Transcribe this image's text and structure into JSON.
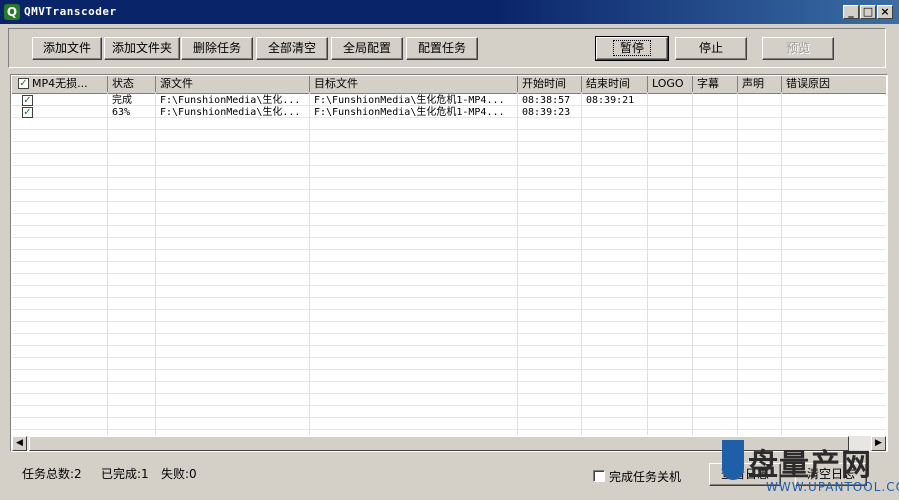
{
  "window": {
    "title": "QMVTranscoder",
    "app_icon": "Q",
    "controls": {
      "minimize": "_",
      "maximize": "□",
      "close": "×"
    }
  },
  "toolbar": {
    "add_file": "添加文件",
    "add_folder": "添加文件夹",
    "delete_task": "删除任务",
    "clear_all": "全部清空",
    "global_config": "全局配置",
    "config_task": "配置任务",
    "pause": "暂停",
    "stop": "停止",
    "preview": "预览"
  },
  "table": {
    "header_check": "✓",
    "columns": [
      "MP4无损...",
      "状态",
      "源文件",
      "目标文件",
      "开始时间",
      "结束时间",
      "LOGO",
      "字幕",
      "声明",
      "错误原因"
    ],
    "rows": [
      {
        "checked": "✓",
        "status": "完成",
        "source": "F:\\FunshionMedia\\生化...",
        "target": "F:\\FunshionMedia\\生化危机1-MP4...",
        "start": "08:38:57",
        "end": "08:39:21"
      },
      {
        "checked": "✓",
        "status": "63%",
        "source": "F:\\FunshionMedia\\生化...",
        "target": "F:\\FunshionMedia\\生化危机1-MP4...",
        "start": "08:39:23",
        "end": ""
      }
    ]
  },
  "scrollbar": {
    "left_arrow": "◀",
    "right_arrow": "▶"
  },
  "status_bar": {
    "total": "任务总数:2",
    "completed": "已完成:1",
    "failed": "失败:0",
    "shutdown_label": "完成任务关机",
    "view_log": "查看日志",
    "clear_log": "清空日志"
  },
  "watermark": {
    "text": "盘量产网",
    "url": "WWW.UPANTOOL.COM"
  },
  "colors": {
    "titlebar": "#0a246a",
    "face": "#d4d0c8",
    "check": "#1a7a1a",
    "watermark": "#1f5fa8"
  }
}
